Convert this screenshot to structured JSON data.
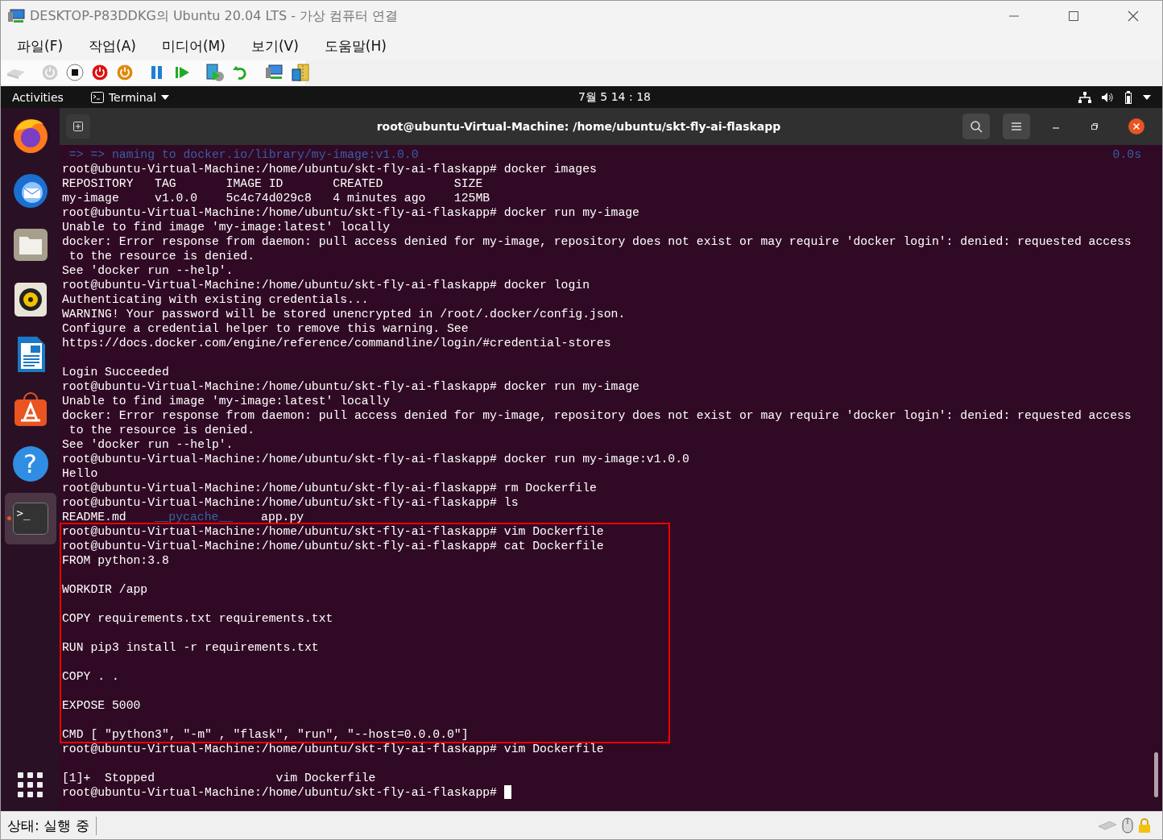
{
  "window": {
    "title": "DESKTOP-P83DDKG의 Ubuntu 20.04 LTS - 가상 컴퓨터 연결"
  },
  "menu": [
    "파일(F)",
    "작업(A)",
    "미디어(M)",
    "보기(V)",
    "도움말(H)"
  ],
  "toolbar": [
    {
      "kind": "keys",
      "disabled": true
    },
    {
      "kind": "sep"
    },
    {
      "kind": "power-gray",
      "disabled": true
    },
    {
      "kind": "stop",
      "disabled": false
    },
    {
      "kind": "power-red",
      "disabled": false
    },
    {
      "kind": "power-orange",
      "disabled": false
    },
    {
      "kind": "sep"
    },
    {
      "kind": "pause",
      "disabled": false
    },
    {
      "kind": "resume",
      "disabled": false
    },
    {
      "kind": "sep"
    },
    {
      "kind": "checkpoint",
      "disabled": false
    },
    {
      "kind": "revert",
      "disabled": false
    },
    {
      "kind": "sep"
    },
    {
      "kind": "network",
      "disabled": false
    },
    {
      "kind": "archive",
      "disabled": false
    }
  ],
  "topbar": {
    "activities": "Activities",
    "app": "Terminal",
    "clock": "7월 5  14 : 18"
  },
  "dock": [
    {
      "kind": "browser",
      "active": false
    },
    {
      "kind": "mail",
      "active": false
    },
    {
      "kind": "folder",
      "active": false
    },
    {
      "kind": "speaker",
      "active": false
    },
    {
      "kind": "document",
      "active": false
    },
    {
      "kind": "store",
      "active": false
    },
    {
      "kind": "help",
      "glyph": "?",
      "active": false
    },
    {
      "kind": "terminal",
      "glyph": ">_",
      "active": true
    }
  ],
  "terminal": {
    "title": "root@ubuntu-Virtual-Machine: /home/ubuntu/skt-fly-ai-flaskapp",
    "blocks": [
      {
        "highlighted": false,
        "lines": [
          {
            "kind": "dim",
            "text": " => => naming to docker.io/library/my-image:v1.0.0",
            "right": "0.0s"
          },
          {
            "text": "root@ubuntu-Virtual-Machine:/home/ubuntu/skt-fly-ai-flaskapp# docker images"
          },
          {
            "text": "REPOSITORY   TAG       IMAGE ID       CREATED          SIZE"
          },
          {
            "text": "my-image     v1.0.0    5c4c74d029c8   4 minutes ago    125MB"
          },
          {
            "text": "root@ubuntu-Virtual-Machine:/home/ubuntu/skt-fly-ai-flaskapp# docker run my-image"
          },
          {
            "text": "Unable to find image 'my-image:latest' locally"
          },
          {
            "text": "docker: Error response from daemon: pull access denied for my-image, repository does not exist or may require 'docker login': denied: requested access"
          },
          {
            "text": " to the resource is denied."
          },
          {
            "text": "See 'docker run --help'."
          },
          {
            "text": "root@ubuntu-Virtual-Machine:/home/ubuntu/skt-fly-ai-flaskapp# docker login"
          },
          {
            "text": "Authenticating with existing credentials..."
          },
          {
            "text": "WARNING! Your password will be stored unencrypted in /root/.docker/config.json."
          },
          {
            "text": "Configure a credential helper to remove this warning. See"
          },
          {
            "text": "https://docs.docker.com/engine/reference/commandline/login/#credential-stores"
          },
          {
            "kind": "blank"
          },
          {
            "text": "Login Succeeded"
          },
          {
            "text": "root@ubuntu-Virtual-Machine:/home/ubuntu/skt-fly-ai-flaskapp# docker run my-image"
          },
          {
            "text": "Unable to find image 'my-image:latest' locally"
          },
          {
            "text": "docker: Error response from daemon: pull access denied for my-image, repository does not exist or may require 'docker login': denied: requested access"
          },
          {
            "text": " to the resource is denied."
          },
          {
            "text": "See 'docker run --help'."
          },
          {
            "text": "root@ubuntu-Virtual-Machine:/home/ubuntu/skt-fly-ai-flaskapp# docker run my-image:v1.0.0"
          },
          {
            "text": "Hello"
          },
          {
            "text": "root@ubuntu-Virtual-Machine:/home/ubuntu/skt-fly-ai-flaskapp# rm Dockerfile"
          },
          {
            "text": "root@ubuntu-Virtual-Machine:/home/ubuntu/skt-fly-ai-flaskapp# ls"
          },
          {
            "kind": "files",
            "files": [
              {
                "name": "README.md",
                "kind": "file"
              },
              {
                "name": "__pycache__",
                "kind": "dir"
              },
              {
                "name": "app.py",
                "kind": "file"
              }
            ]
          }
        ]
      },
      {
        "highlighted": true,
        "lines": [
          {
            "text": "root@ubuntu-Virtual-Machine:/home/ubuntu/skt-fly-ai-flaskapp# vim Dockerfile"
          },
          {
            "text": "root@ubuntu-Virtual-Machine:/home/ubuntu/skt-fly-ai-flaskapp# cat Dockerfile"
          },
          {
            "text": "FROM python:3.8"
          },
          {
            "kind": "blank"
          },
          {
            "text": "WORKDIR /app"
          },
          {
            "kind": "blank"
          },
          {
            "text": "COPY requirements.txt requirements.txt"
          },
          {
            "kind": "blank"
          },
          {
            "text": "RUN pip3 install -r requirements.txt"
          },
          {
            "kind": "blank"
          },
          {
            "text": "COPY . ."
          },
          {
            "kind": "blank"
          },
          {
            "text": "EXPOSE 5000"
          },
          {
            "kind": "blank"
          },
          {
            "text": "CMD [ \"python3\", \"-m\" , \"flask\", \"run\", \"--host=0.0.0.0\"]"
          }
        ]
      },
      {
        "highlighted": false,
        "lines": [
          {
            "text": "root@ubuntu-Virtual-Machine:/home/ubuntu/skt-fly-ai-flaskapp# vim Dockerfile"
          },
          {
            "kind": "blank"
          },
          {
            "text": "[1]+  Stopped                 vim Dockerfile"
          },
          {
            "text": "root@ubuntu-Virtual-Machine:/home/ubuntu/skt-fly-ai-flaskapp# ",
            "cursor": true
          }
        ]
      }
    ]
  },
  "status_bar": {
    "text": "상태: 실행 중"
  }
}
